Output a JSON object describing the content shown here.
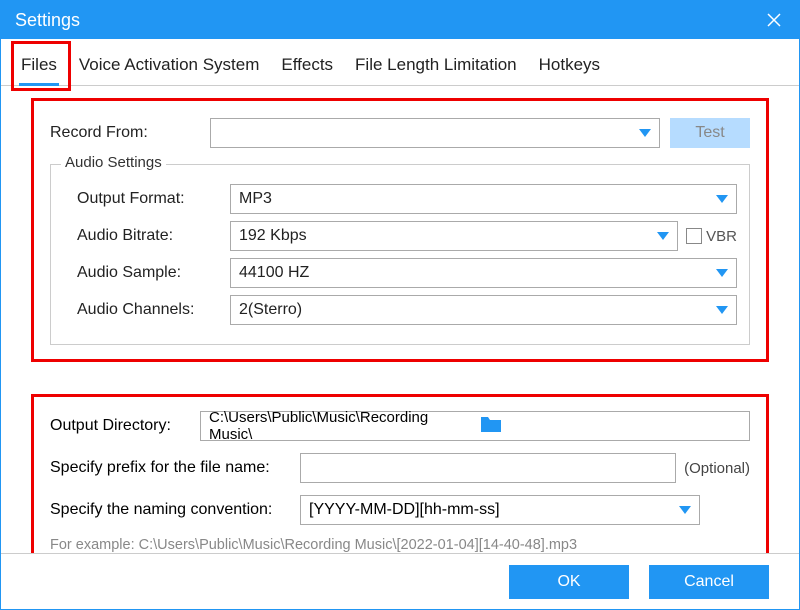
{
  "window": {
    "title": "Settings"
  },
  "tabs": {
    "items": [
      "Files",
      "Voice Activation System",
      "Effects",
      "File Length Limitation",
      "Hotkeys"
    ],
    "active": 0
  },
  "record": {
    "label": "Record  From:",
    "value": "",
    "test_label": "Test"
  },
  "audio_settings": {
    "legend": "Audio Settings",
    "output_format": {
      "label": "Output Format:",
      "value": "MP3"
    },
    "bitrate": {
      "label": "Audio Bitrate:",
      "value": "192 Kbps",
      "vbr_label": "VBR",
      "vbr_checked": false
    },
    "sample": {
      "label": "Audio Sample:",
      "value": "44100 HZ"
    },
    "channels": {
      "label": "Audio Channels:",
      "value": "2(Sterro)"
    }
  },
  "output": {
    "dir_label": "Output Directory:",
    "dir_value": "C:\\Users\\Public\\Music\\Recording Music\\",
    "prefix_label": "Specify prefix for the file name:",
    "prefix_value": "",
    "prefix_optional": "(Optional)",
    "naming_label": "Specify the naming convention:",
    "naming_value": "[YYYY-MM-DD][hh-mm-ss]",
    "example": "For example: C:\\Users\\Public\\Music\\Recording Music\\[2022-01-04][14-40-48].mp3"
  },
  "buttons": {
    "ok": "OK",
    "cancel": "Cancel"
  }
}
